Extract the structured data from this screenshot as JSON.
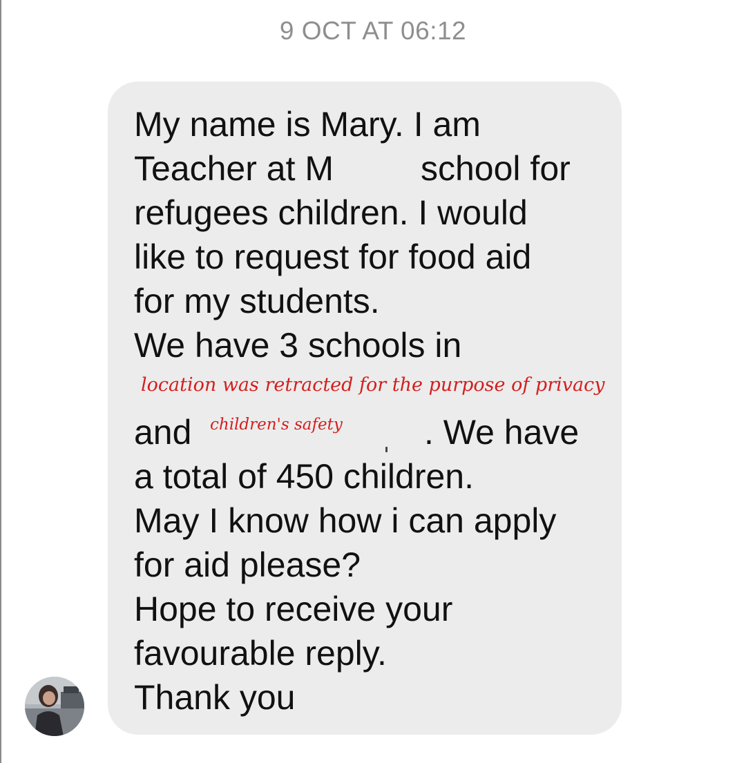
{
  "conversation": {
    "timestamp": "9 OCT AT 06:12"
  },
  "message": {
    "lines": [
      "My name is Mary. I am",
      "Teacher at M",
      "school for",
      "refugees children. I would",
      "like to request for food aid",
      "for my students.",
      "We have 3 schools in",
      "and",
      ". We have",
      "a total of 450 children.",
      "May I know how i can apply",
      "for aid please?",
      "Hope to receive your",
      "favourable reply.",
      "Thank you"
    ],
    "redaction_notes": {
      "location": "location was retracted for the purpose of privacy",
      "safety": "children's safety"
    }
  },
  "sender": {
    "avatar_icon": "avatar-photo",
    "colors": {
      "bubble": "#ececec",
      "timestamp": "#8e8e8e",
      "redaction_note": "#d41e1e"
    }
  }
}
